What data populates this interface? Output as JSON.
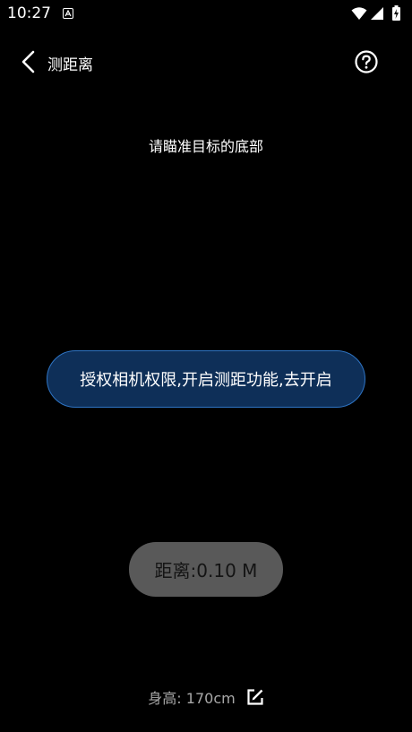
{
  "status_bar": {
    "time": "10:27",
    "app_icon": "a-icon",
    "wifi_icon": "wifi-icon",
    "signal_icon": "signal-icon",
    "battery_icon": "battery-charging-icon"
  },
  "nav": {
    "back_icon": "chevron-left-icon",
    "title": "测距离",
    "help_icon": "question-circle-icon"
  },
  "instruction": "请瞄准目标的底部",
  "auth_button": {
    "label": "授权相机权限,开启测距功能,去开启"
  },
  "distance": {
    "text": "距离:0.10 M"
  },
  "height": {
    "text": "身高: 170cm",
    "edit_icon": "edit-icon"
  },
  "colors": {
    "background": "#000000",
    "auth_button_bg": "#0e2f58",
    "auth_button_border": "#2e74c4",
    "distance_pill_bg": "#595959",
    "height_text": "#a8a8a8"
  }
}
